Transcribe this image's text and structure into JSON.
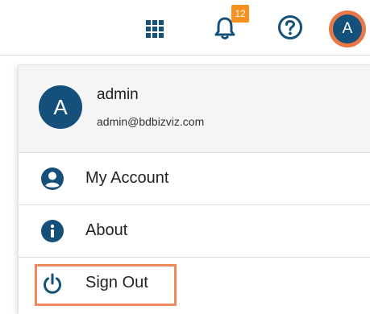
{
  "topbar": {
    "apps_icon": "apps-grid-icon",
    "notifications": {
      "icon": "bell-icon",
      "badge_count": "12"
    },
    "help_icon": "help-circle-icon",
    "avatar_letter": "A"
  },
  "user": {
    "initial": "A",
    "name": "admin",
    "email": "admin@bdbizviz.com"
  },
  "menu": {
    "items": [
      {
        "label": "My Account",
        "icon": "user-circle-icon"
      },
      {
        "label": "About",
        "icon": "info-icon"
      },
      {
        "label": "Sign Out",
        "icon": "power-icon"
      }
    ]
  },
  "colors": {
    "primary": "#15507a",
    "badge": "#f6901e",
    "highlight": "#ef8a5d"
  }
}
